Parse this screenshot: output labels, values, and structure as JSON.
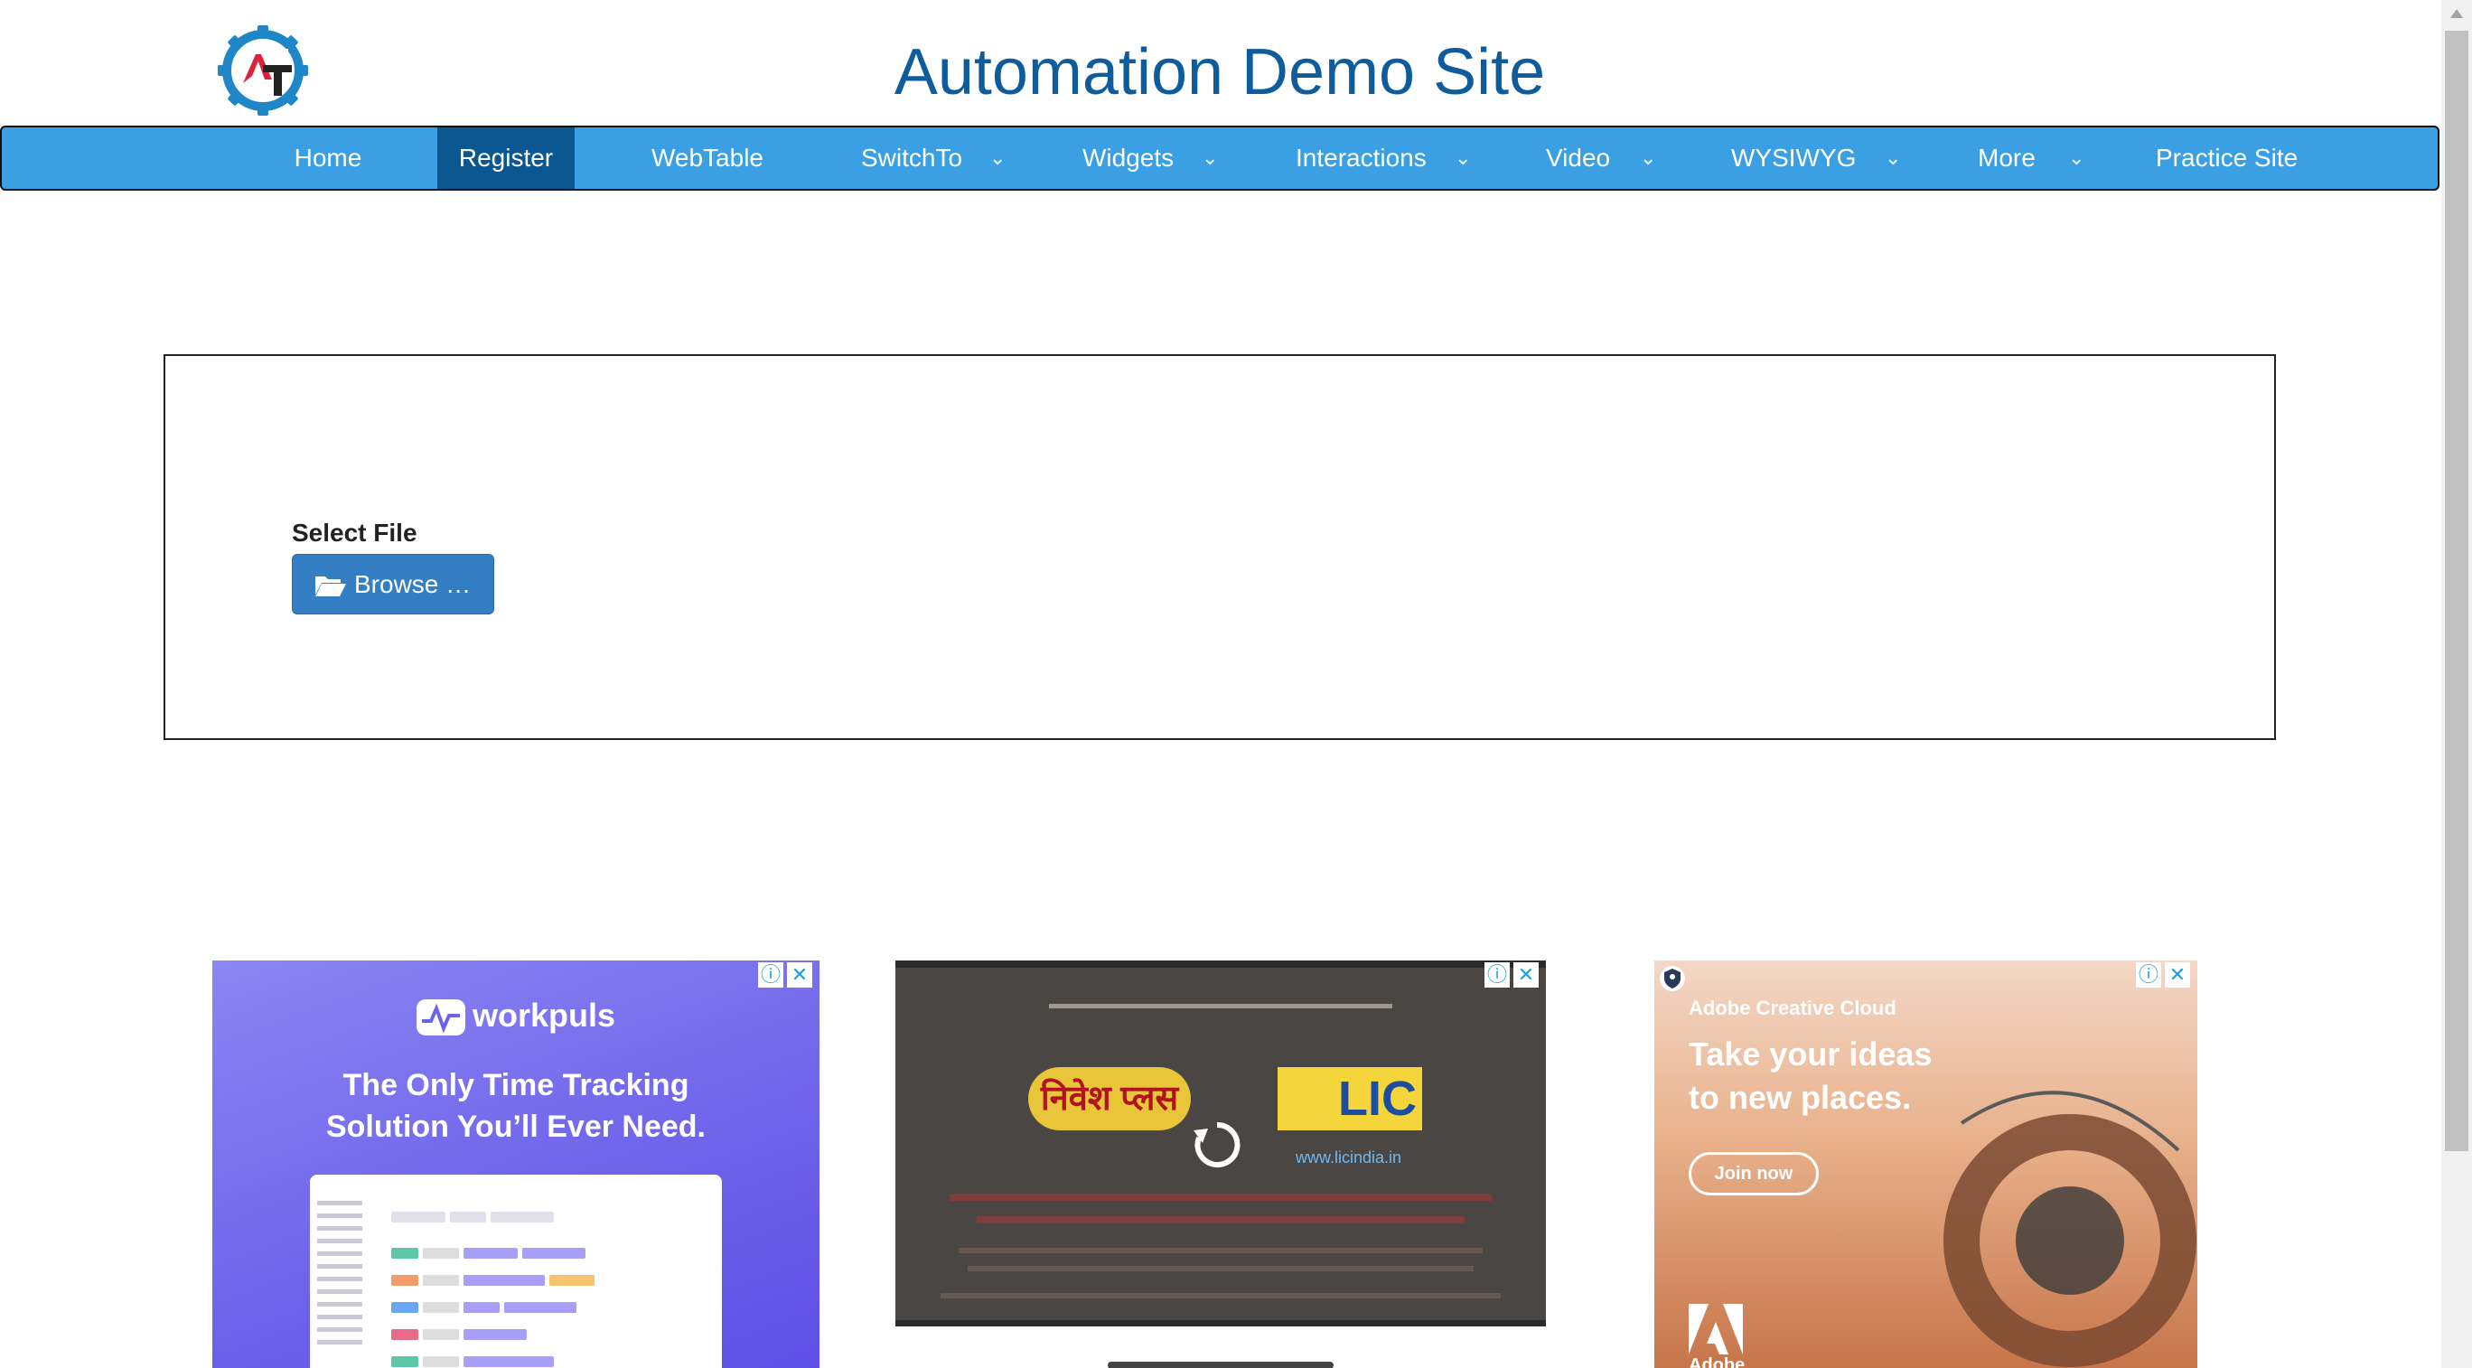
{
  "header": {
    "title": "Automation Demo Site",
    "logo_text": "AT"
  },
  "nav": {
    "items": [
      {
        "label": "Home",
        "dropdown": false,
        "active": false
      },
      {
        "label": "Register",
        "dropdown": false,
        "active": true
      },
      {
        "label": "WebTable",
        "dropdown": false,
        "active": false
      },
      {
        "label": "SwitchTo",
        "dropdown": true,
        "active": false
      },
      {
        "label": "Widgets",
        "dropdown": true,
        "active": false
      },
      {
        "label": "Interactions",
        "dropdown": true,
        "active": false
      },
      {
        "label": "Video",
        "dropdown": true,
        "active": false
      },
      {
        "label": "WYSIWYG",
        "dropdown": true,
        "active": false
      },
      {
        "label": "More",
        "dropdown": true,
        "active": false
      },
      {
        "label": "Practice Site",
        "dropdown": false,
        "active": false
      }
    ],
    "chevron": "⌄"
  },
  "upload": {
    "label": "Select File",
    "button_label": "Browse …",
    "button_icon": "folder-open-icon"
  },
  "ads": {
    "workpuls": {
      "brand": "workpuls",
      "headline_line1": "The Only Time Tracking",
      "headline_line2": "Solution You’ll Ever Need."
    },
    "lic": {
      "nivesh": "निवेश प्लस",
      "lic": "LIC",
      "url": "www.licindia.in"
    },
    "adobe": {
      "brand": "Adobe Creative Cloud",
      "headline_line1": "Take your ideas",
      "headline_line2": "to new places.",
      "cta": "Join now",
      "logo_text": "Adobe"
    },
    "info_icon": "ⓘ",
    "close_icon": "✕"
  },
  "colors": {
    "nav_bg": "#3aa0e3",
    "nav_active": "#0a5791",
    "title": "#0e5c9c",
    "button": "#347ec3"
  }
}
